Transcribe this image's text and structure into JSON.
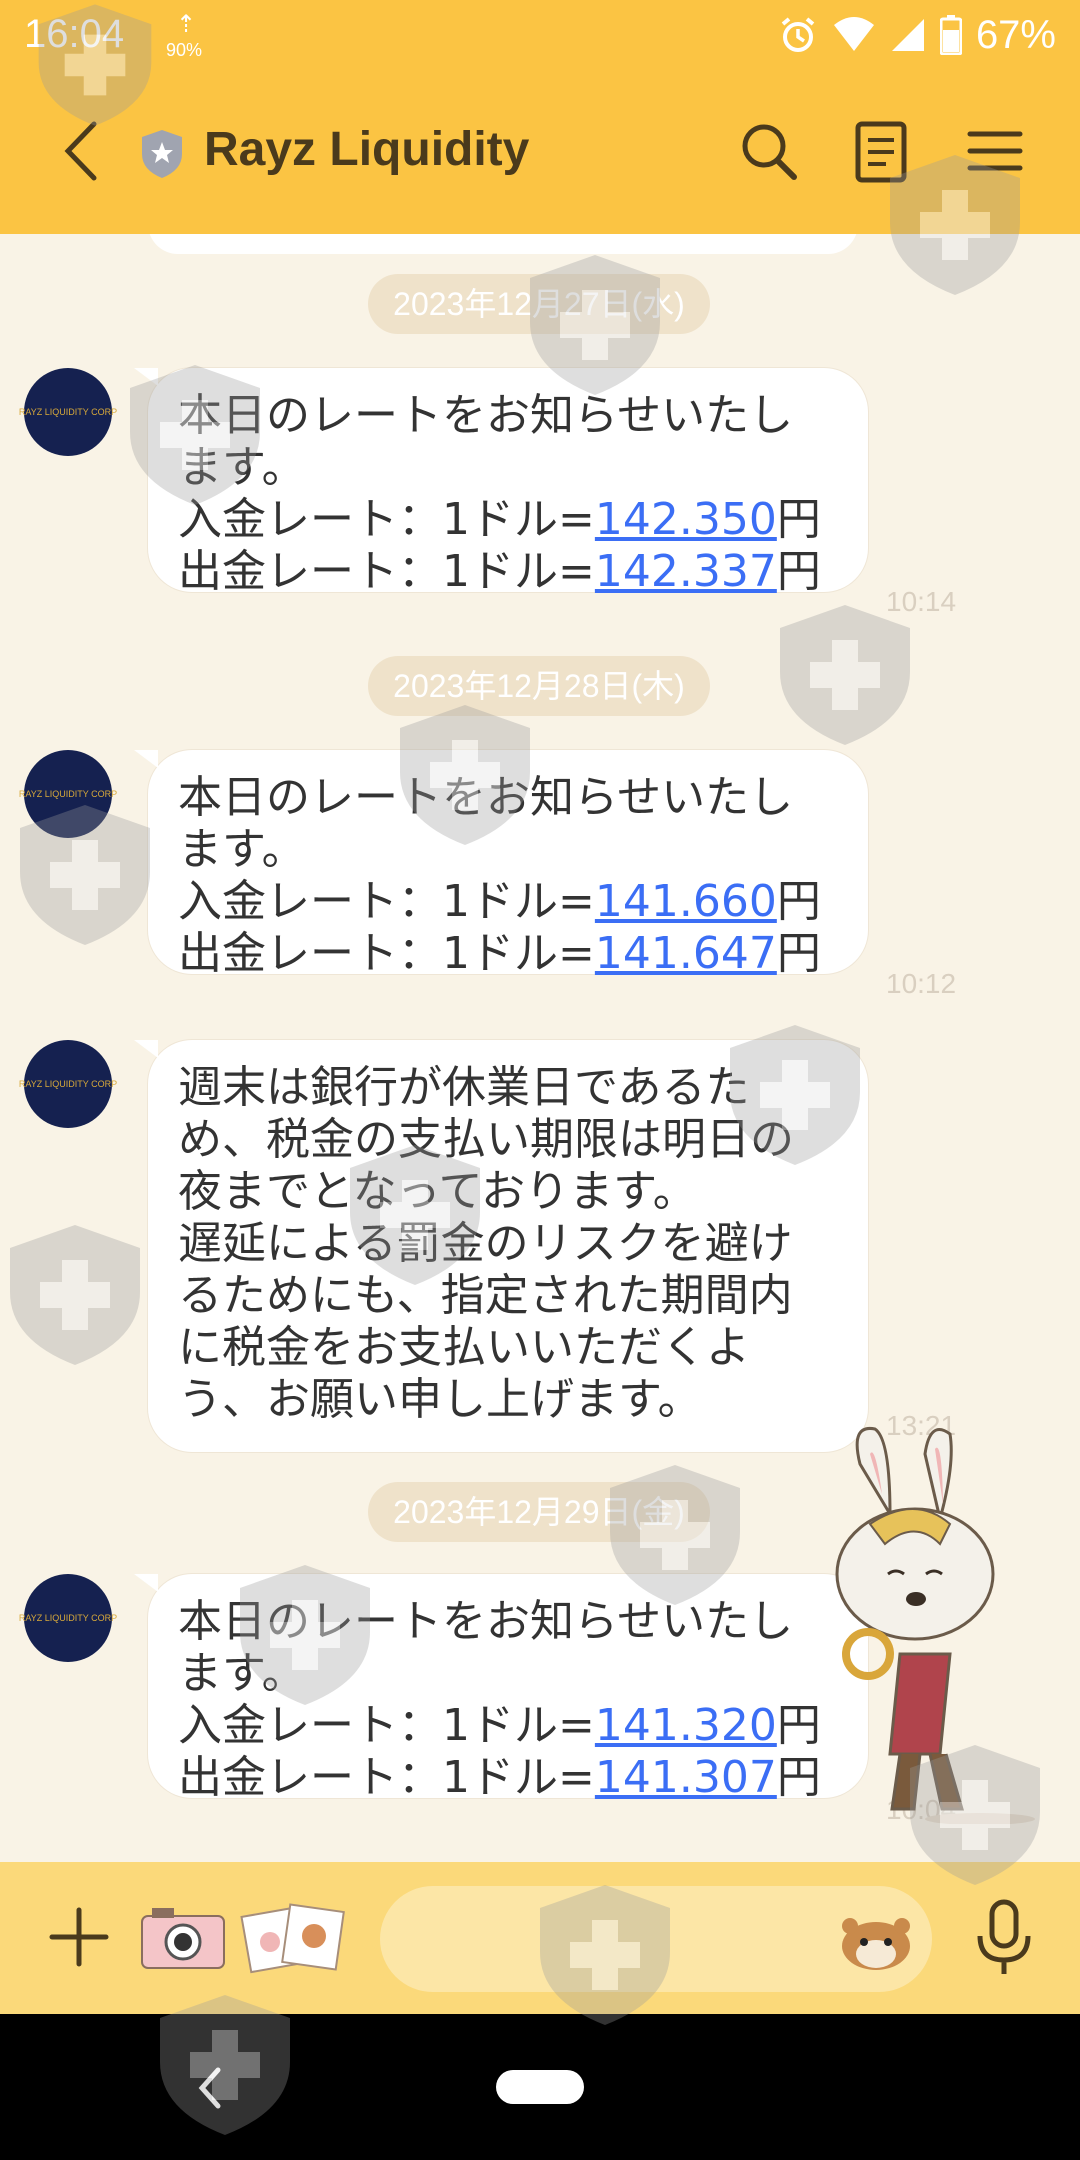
{
  "status_bar": {
    "time": "16:04",
    "data_speed": "90%",
    "battery": "67%"
  },
  "header": {
    "title": "Rayz Liquidity",
    "accent_color": "#fbc443"
  },
  "avatar_label": "RAYZ LIQUIDITY CORP",
  "messages": [
    {
      "date": "2023年12月27日(水)",
      "line1": "本日のレートをお知らせいたし",
      "line2": "ます。",
      "deposit_prefix": "入金レート：1ドル=",
      "deposit_rate": "142.350",
      "withdraw_prefix": "出金レート：1ドル=",
      "withdraw_rate": "142.337",
      "yen": "円",
      "time": "10:14"
    },
    {
      "date": "2023年12月28日(木)",
      "line1": "本日のレートをお知らせいたし",
      "line2": "ます。",
      "deposit_prefix": "入金レート：1ドル=",
      "deposit_rate": "141.660",
      "withdraw_prefix": "出金レート：1ドル=",
      "withdraw_rate": "141.647",
      "yen": "円",
      "time": "10:12"
    },
    {
      "lines": [
        "週末は銀行が休業日であるた",
        "め、税金の支払い期限は明日の",
        "夜までとなっております。",
        "遅延による罰金のリスクを避け",
        "るためにも、指定された期間内",
        "に税金をお支払いいただくよ",
        "う、お願い申し上げます。"
      ],
      "time": "13:21"
    },
    {
      "date": "2023年12月29日(金)",
      "line1": "本日のレートをお知らせいたし",
      "line2": "ます。",
      "deposit_prefix": "入金レート：1ドル=",
      "deposit_rate": "141.320",
      "withdraw_prefix": "出金レート：1ドル=",
      "withdraw_rate": "141.307",
      "yen": "円",
      "time": "10:04"
    }
  ],
  "icons": {
    "back": "chevron-left-icon",
    "search": "search-icon",
    "notes": "notes-icon",
    "menu": "hamburger-menu-icon",
    "plus": "plus-icon",
    "camera": "camera-icon",
    "album": "photo-album-icon",
    "sticker": "hamster-sticker-icon",
    "mic": "microphone-icon"
  }
}
